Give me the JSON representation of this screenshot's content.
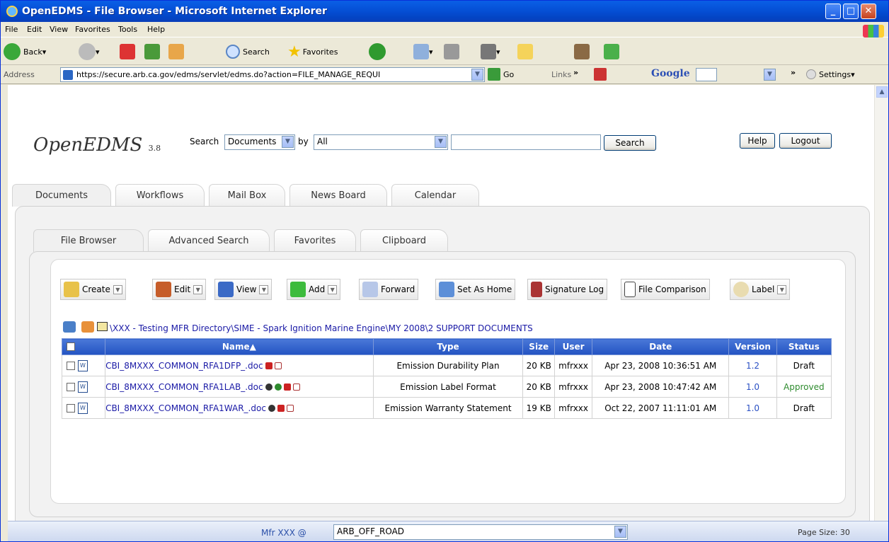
{
  "window": {
    "title": "OpenEDMS - File Browser - Microsoft Internet Explorer"
  },
  "menu": [
    "File",
    "Edit",
    "View",
    "Favorites",
    "Tools",
    "Help"
  ],
  "toolbar": {
    "back": "Back",
    "search": "Search",
    "favorites": "Favorites"
  },
  "address": {
    "label": "Address",
    "url": "https://secure.arb.ca.gov/edms/servlet/edms.do?action=FILE_MANAGE_REQUI",
    "go": "Go",
    "links": "Links",
    "google": "Google",
    "settings": "Settings"
  },
  "app": {
    "logo": "OpenEDMS",
    "version": "3.8",
    "search_label": "Search",
    "search_type": "Documents",
    "by_label": "by",
    "by_value": "All",
    "search_btn": "Search",
    "help_btn": "Help",
    "logout_btn": "Logout"
  },
  "main_tabs": [
    "Documents",
    "Workflows",
    "Mail Box",
    "News Board",
    "Calendar"
  ],
  "sub_tabs": [
    "File Browser",
    "Advanced Search",
    "Favorites",
    "Clipboard"
  ],
  "actions": [
    "Create",
    "Edit",
    "View",
    "Add",
    "Forward",
    "Set As Home",
    "Signature Log",
    "File Comparison",
    "Label"
  ],
  "path": "\\XXX - Testing MFR Directory\\SIME - Spark Ignition Marine Engine\\MY 2008\\2 SUPPORT DOCUMENTS",
  "table": {
    "headers": [
      "Name▲",
      "Type",
      "Size",
      "User",
      "Date",
      "Version",
      "Status"
    ],
    "rows": [
      {
        "name": "CBI_8MXXX_COMMON_RFA1DFP_.doc",
        "type": "Emission Durability Plan",
        "size": "20 KB",
        "user": "mfrxxx",
        "date": "Apr 23, 2008 10:36:51 AM",
        "version": "1.2",
        "status": "Draft"
      },
      {
        "name": "CBI_8MXXX_COMMON_RFA1LAB_.doc",
        "type": "Emission Label Format",
        "size": "20 KB",
        "user": "mfrxxx",
        "date": "Apr 23, 2008 10:47:42 AM",
        "version": "1.0",
        "status": "Approved"
      },
      {
        "name": "CBI_8MXXX_COMMON_RFA1WAR_.doc",
        "type": "Emission Warranty Statement",
        "size": "19 KB",
        "user": "mfrxxx",
        "date": "Oct 22, 2007 11:11:01 AM",
        "version": "1.0",
        "status": "Draft"
      }
    ]
  },
  "status": {
    "mfr": "Mfr XXX @",
    "org": "ARB_OFF_ROAD",
    "page_size": "Page Size: 30"
  }
}
